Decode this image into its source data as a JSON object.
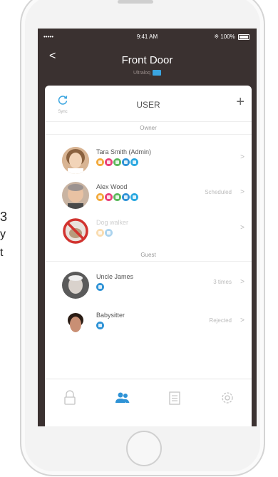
{
  "status_bar": {
    "signal": "•••••",
    "time": "9:41 AM",
    "battery": "100%"
  },
  "header": {
    "back_label": "<",
    "title": "Front Door",
    "subtitle": "Ultraloq"
  },
  "card": {
    "sync_label": "Sync",
    "title": "USER",
    "add_label": "+"
  },
  "sections": {
    "owner": "Owner",
    "guest": "Guest"
  },
  "owners": [
    {
      "name": "Tara Smith (Admin)",
      "status": "",
      "chevron": ">",
      "access_icons": [
        "code",
        "fingerprint",
        "ekey",
        "card",
        "wifi"
      ],
      "disabled": false
    },
    {
      "name": "Alex Wood",
      "status": "Scheduled",
      "chevron": ">",
      "access_icons": [
        "code",
        "fingerprint",
        "ekey",
        "card",
        "wifi"
      ],
      "disabled": false
    },
    {
      "name": "Dog walker",
      "status": "",
      "chevron": ">",
      "access_icons": [
        "code",
        "card"
      ],
      "disabled": true
    }
  ],
  "guests": [
    {
      "name": "Uncle James",
      "status": "3 times",
      "chevron": ">",
      "access_icons": [
        "card"
      ]
    },
    {
      "name": "Babysitter",
      "status": "Rejected",
      "chevron": ">",
      "access_icons": [
        "card"
      ]
    }
  ],
  "tabs": [
    {
      "name": "lock-icon",
      "active": false
    },
    {
      "name": "users-icon",
      "active": true
    },
    {
      "name": "log-icon",
      "active": false
    },
    {
      "name": "settings-icon",
      "active": false
    }
  ],
  "side_text": [
    "3",
    "y",
    "t"
  ],
  "colors": {
    "accent": "#3aa5e0",
    "code": "#f2a93b",
    "fingerprint": "#e8407a",
    "ekey": "#5cb85c",
    "card": "#2f93d6",
    "wifi": "#2aa8e0"
  }
}
